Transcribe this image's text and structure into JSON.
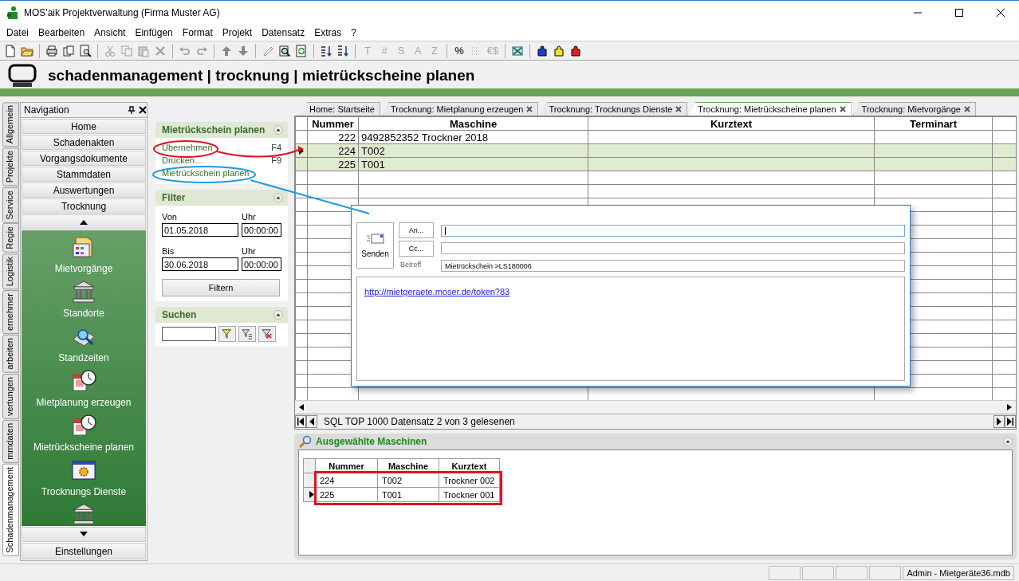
{
  "window": {
    "title": "MOS'aik Projektverwaltung (Firma Muster AG)"
  },
  "menu": [
    "Datei",
    "Bearbeiten",
    "Ansicht",
    "Einfügen",
    "Format",
    "Projekt",
    "Datensatz",
    "Extras",
    "?"
  ],
  "toolbar_glyphs": [
    {
      "label": "T",
      "disabled": true
    },
    {
      "label": "#",
      "disabled": true
    },
    {
      "label": "S",
      "disabled": true
    },
    {
      "label": "A",
      "disabled": true
    },
    {
      "label": "Z",
      "disabled": true
    },
    {
      "label": "%",
      "disabled": false
    },
    {
      "label": "€$",
      "disabled": true
    }
  ],
  "breadcrumb": "schadenmanagement | trocknung | mietrückscheine planen",
  "side_tabs": [
    {
      "label": "Allgemein",
      "selected": false
    },
    {
      "label": "Projekte",
      "selected": false
    },
    {
      "label": "Service",
      "selected": false
    },
    {
      "label": "Regie",
      "selected": false
    },
    {
      "label": "Logistik",
      "selected": false
    },
    {
      "label": "ernehmer",
      "selected": false
    },
    {
      "label": "arbeiten",
      "selected": false
    },
    {
      "label": "vertungen",
      "selected": false
    },
    {
      "label": "mmdaten",
      "selected": false
    },
    {
      "label": "Schadenmanagement",
      "selected": true
    }
  ],
  "navigation": {
    "title": "Navigation",
    "groups": [
      "Home",
      "Schadenakten",
      "Vorgangsdokumente",
      "Stammdaten",
      "Auswertungen",
      "Trocknung"
    ],
    "items": [
      {
        "label": "Mietvorgänge",
        "kind": "folder"
      },
      {
        "label": "Standorte",
        "kind": "building"
      },
      {
        "label": "Standzeiten",
        "kind": "search"
      },
      {
        "label": "Mietplanung erzeugen",
        "kind": "calendar"
      },
      {
        "label": "Mietrückscheine planen",
        "kind": "calendar"
      },
      {
        "label": "Trocknungs Dienste",
        "kind": "gear"
      }
    ],
    "footer": "Einstellungen"
  },
  "tasks": {
    "title": "Mietrückschein planen",
    "actions": [
      {
        "label": "Übernehmen",
        "shortcut": "F4"
      },
      {
        "label": "Drucken…",
        "shortcut": "F9"
      },
      {
        "label": "Mietrückschein planen"
      }
    ]
  },
  "filter": {
    "title": "Filter",
    "from_label": "Von",
    "from_time_label": "Uhr",
    "from_date": "01.05.2018",
    "from_time": "00:00:00",
    "to_label": "Bis",
    "to_time_label": "Uhr",
    "to_date": "30.06.2018",
    "to_time": "00:00:00",
    "button": "Filtern"
  },
  "search": {
    "title": "Suchen"
  },
  "doc_tabs": [
    {
      "label": "Home: Startseite",
      "closable": false,
      "selected": false
    },
    {
      "label": "Trocknung: Mietplanung erzeugen",
      "closable": true,
      "selected": false
    },
    {
      "label": "Trocknung: Trocknungs Dienste",
      "closable": true,
      "selected": false
    },
    {
      "label": "Trocknung: Mietrückscheine planen",
      "closable": true,
      "selected": true
    },
    {
      "label": "Trocknung: Mietvorgänge",
      "closable": true,
      "selected": false
    }
  ],
  "grid": {
    "columns": [
      "Nummer",
      "Maschine",
      "Kurztext",
      "Terminart"
    ],
    "rows": [
      {
        "cells": [
          "222",
          "9492852352 Trockner 2018"
        ],
        "selected": false,
        "current": false
      },
      {
        "cells": [
          "224",
          "T002"
        ],
        "selected": true,
        "current": true
      },
      {
        "cells": [
          "225",
          "T001"
        ],
        "selected": true,
        "current": false
      }
    ],
    "status": "SQL TOP 1000 Datensatz 2 von 3 gelesenen"
  },
  "selected_panel": {
    "title": "Ausgewählte Maschinen",
    "columns": [
      "Nummer",
      "Maschine",
      "Kurztext"
    ],
    "rows": [
      {
        "cells": [
          "224",
          "T002",
          "Trockner 002"
        ],
        "current": false
      },
      {
        "cells": [
          "225",
          "T001",
          "Trockner 001"
        ],
        "current": true
      }
    ]
  },
  "email": {
    "send": "Senden",
    "to_button": "An...",
    "cc_button": "Cc...",
    "subject_label": "Betreff",
    "subject": "Mietrückschein >LS180006",
    "body_link": "http://mietgeraete.moser.de/token?83"
  },
  "status_bar": {
    "text": "Admin - Mietgeräte36.mdb"
  }
}
